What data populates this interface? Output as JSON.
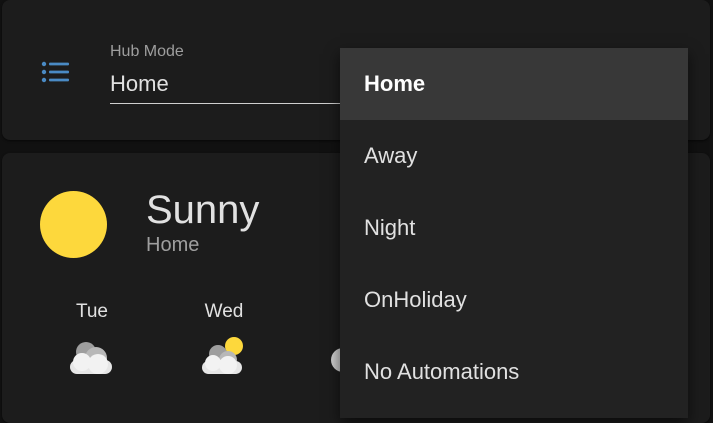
{
  "hub_mode": {
    "label": "Hub Mode",
    "value": "Home",
    "menu_icon": "list-icon",
    "options": [
      {
        "label": "Home",
        "selected": true
      },
      {
        "label": "Away",
        "selected": false
      },
      {
        "label": "Night",
        "selected": false
      },
      {
        "label": "OnHoliday",
        "selected": false
      },
      {
        "label": "No Automations",
        "selected": false
      }
    ]
  },
  "weather": {
    "condition": "Sunny",
    "location": "Home",
    "icon": "sun-icon",
    "forecast": [
      {
        "day": "Tue",
        "icon": "cloudy-icon"
      },
      {
        "day": "Wed",
        "icon": "partly-cloudy-icon"
      }
    ]
  },
  "colors": {
    "accent": "#4a8ac4",
    "sun": "#fdd83c",
    "background": "#111111",
    "card": "#1c1c1c",
    "menu": "#222222",
    "menu_selected": "#383838"
  }
}
